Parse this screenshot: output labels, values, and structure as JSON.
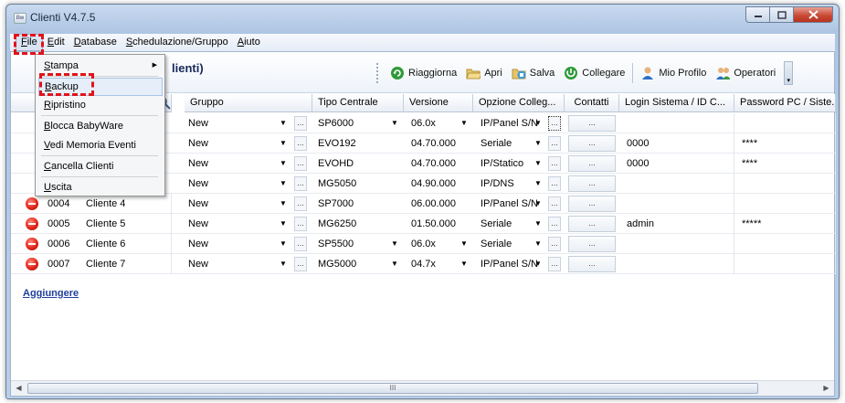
{
  "window": {
    "title": "Clienti V4.7.5",
    "app_icon_text": "Bw"
  },
  "menubar": {
    "items": [
      {
        "label": "File",
        "underline": "F",
        "rest": "ile"
      },
      {
        "label": "Edit",
        "underline": "E",
        "rest": "dit"
      },
      {
        "label": "Database",
        "underline": "D",
        "rest": "atabase"
      },
      {
        "label": "Schedulazione/Gruppo",
        "underline": "S",
        "rest": "chedulazione/Gruppo"
      },
      {
        "label": "Aiuto",
        "underline": "A",
        "rest": "iuto"
      }
    ]
  },
  "header": {
    "title_fragment": "lienti)"
  },
  "toolbar": {
    "refresh_label": "Riaggiorna",
    "open_label": "Apri",
    "save_label": "Salva",
    "connect_label": "Collegare",
    "profile_label": "Mio Profilo",
    "operators_label": "Operatori"
  },
  "grid": {
    "columns": {
      "gruppo": "Gruppo",
      "tipo_centrale": "Tipo Centrale",
      "versione": "Versione",
      "opzione": "Opzione Colleg...",
      "contatti": "Contatti",
      "login": "Login Sistema / ID C...",
      "password": "Password PC / Siste..."
    },
    "contact_button_label": "...",
    "ellipsis_label": "...",
    "rows": [
      {
        "id": "",
        "name": "",
        "gruppo": "New",
        "tipo": "SP6000",
        "tipo_dd": true,
        "versione": "06.0x",
        "ver_dd": true,
        "opzione": "IP/Panel S/N",
        "login": "",
        "password": ""
      },
      {
        "id": "",
        "name": "",
        "gruppo": "New",
        "tipo": "EVO192",
        "tipo_dd": false,
        "versione": "04.70.000",
        "ver_dd": false,
        "opzione": "Seriale",
        "login": "0000",
        "password": "****"
      },
      {
        "id": "",
        "name": "",
        "gruppo": "New",
        "tipo": "EVOHD",
        "tipo_dd": false,
        "versione": "04.70.000",
        "ver_dd": false,
        "opzione": "IP/Statico",
        "login": "0000",
        "password": "****"
      },
      {
        "id": "",
        "name": "",
        "gruppo": "New",
        "tipo": "MG5050",
        "tipo_dd": false,
        "versione": "04.90.000",
        "ver_dd": false,
        "opzione": "IP/DNS",
        "login": "",
        "password": ""
      },
      {
        "id": "0004",
        "name": "Cliente 4",
        "gruppo": "New",
        "tipo": "SP7000",
        "tipo_dd": false,
        "versione": "06.00.000",
        "ver_dd": false,
        "opzione": "IP/Panel S/N",
        "login": "",
        "password": ""
      },
      {
        "id": "0005",
        "name": "Cliente 5",
        "gruppo": "New",
        "tipo": "MG6250",
        "tipo_dd": false,
        "versione": "01.50.000",
        "ver_dd": false,
        "opzione": "Seriale",
        "login": "admin",
        "password": "*****"
      },
      {
        "id": "0006",
        "name": "Cliente 6",
        "gruppo": "New",
        "tipo": "SP5500",
        "tipo_dd": true,
        "versione": "06.0x",
        "ver_dd": true,
        "opzione": "Seriale",
        "login": "",
        "password": ""
      },
      {
        "id": "0007",
        "name": "Cliente 7",
        "gruppo": "New",
        "tipo": "MG5000",
        "tipo_dd": true,
        "versione": "04.7x",
        "ver_dd": true,
        "opzione": "IP/Panel S/N",
        "login": "",
        "password": ""
      }
    ]
  },
  "add_link": "Aggiungere",
  "scrollbar": {
    "thumb_grip": "III"
  },
  "file_menu": {
    "items": [
      {
        "label": "Stampa",
        "underline": "S",
        "rest": "tampa",
        "submenu": true
      },
      {
        "label": "Backup",
        "underline": "B",
        "rest": "ackup",
        "submenu": false
      },
      {
        "label": "Ripristino",
        "underline": "R",
        "rest": "ipristino",
        "submenu": false
      },
      {
        "label": "Blocca BabyWare",
        "underline": "B",
        "rest": "locca BabyWare",
        "submenu": false
      },
      {
        "label": "Vedi Memoria Eventi",
        "underline": "V",
        "rest": "edi Memoria Eventi",
        "submenu": false
      },
      {
        "label": "Cancella Clienti",
        "underline": "C",
        "rest": "ancella Clienti",
        "submenu": false
      },
      {
        "label": "Uscita",
        "underline": "U",
        "rest": "scita",
        "submenu": false
      }
    ]
  },
  "colors": {
    "annotation": "#e3121a",
    "link": "#1f3f9e",
    "stop_icon": "#e0251b"
  },
  "icons": {
    "refresh": "refresh-icon",
    "open": "folder-open-icon",
    "save": "save-icon",
    "connect": "connect-icon",
    "profile": "user-icon",
    "operators": "users-icon",
    "search": "search-icon",
    "stop": "stop-icon"
  }
}
